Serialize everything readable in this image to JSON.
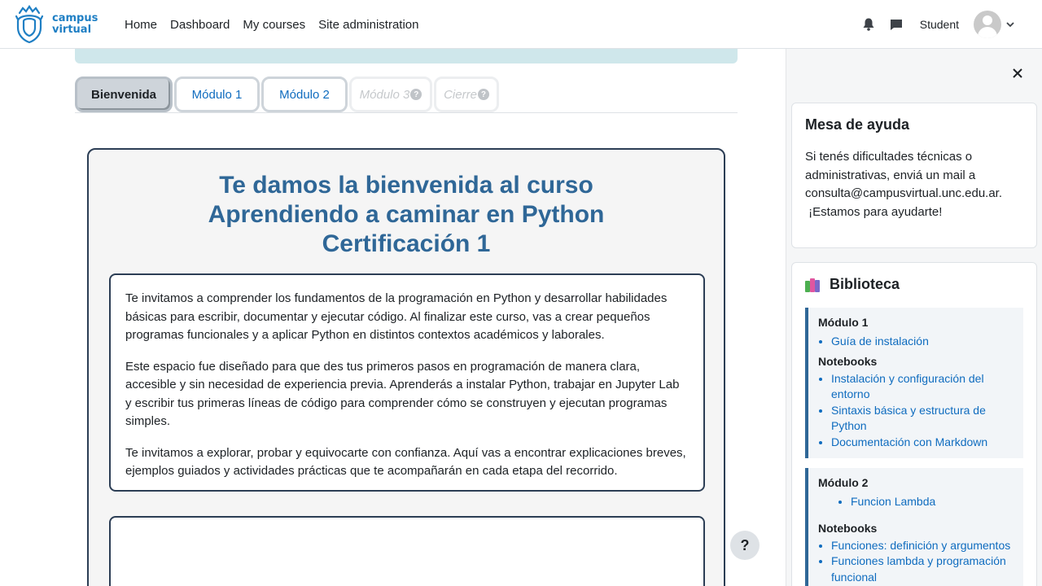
{
  "logo": {
    "line1": "campus",
    "line2": "virtual"
  },
  "nav": {
    "links": [
      "Home",
      "Dashboard",
      "My courses",
      "Site administration"
    ],
    "user": "Student"
  },
  "tabs": [
    {
      "label": "Bienvenida",
      "state": "active"
    },
    {
      "label": "Módulo 1",
      "state": "normal"
    },
    {
      "label": "Módulo 2",
      "state": "normal"
    },
    {
      "label": "Módulo 3",
      "state": "disabled",
      "badge": "?"
    },
    {
      "label": "Cierre",
      "state": "disabled",
      "badge": "?"
    }
  ],
  "course": {
    "title_line1": "Te damos la bienvenida al curso",
    "title_line2": "Aprendiendo a caminar en Python",
    "title_line3": "Certificación 1",
    "paragraphs": [
      "Te invitamos a  comprender los fundamentos de la programación en Python y desarrollar habilidades básicas para escribir, documentar y ejecutar código. Al finalizar este curso, vas a crear pequeños programas funcionales y a aplicar Python en distintos contextos académicos y laborales.",
      "Este espacio fue diseñado para que des tus primeros pasos en programación de manera clara, accesible y sin necesidad de experiencia previa. Aprenderás a instalar Python, trabajar en Jupyter Lab y escribir tus primeras líneas de código para comprender cómo se construyen y ejecutan programas simples.",
      "Te invitamos a explorar, probar y equivocarte con confianza. Aquí vas a encontrar explicaciones breves, ejemplos guiados y actividades prácticas que te acompañarán en cada etapa del recorrido."
    ]
  },
  "help_button": "?",
  "drawer": {
    "help_block": {
      "title": "Mesa de ayuda",
      "text_line1": "Si tenés dificultades técnicas o",
      "text_line2": "administrativas, enviá un mail a",
      "text_line3": "consulta@campusvirtual.unc.edu.ar.",
      "text_line4": " ¡Estamos para ayudarte!"
    },
    "library": {
      "title": "Biblioteca",
      "modules": [
        {
          "title": "Módulo 1",
          "links": [
            "Guía de instalación"
          ],
          "notebooks_label": "Notebooks",
          "notebooks": [
            "Instalación y configuración del entorno",
            "Sintaxis básica y estructura de Python",
            "Documentación con Markdown"
          ]
        },
        {
          "title": "Módulo 2",
          "links": [
            "Funcion Lambda"
          ],
          "notebooks_label": "Notebooks",
          "notebooks": [
            "Funciones: definición y argumentos",
            "Funciones lambda y programación funcional"
          ]
        }
      ]
    }
  },
  "colors": {
    "title_blue": "#2f6797",
    "link_blue": "#0f6cbf",
    "border_dark": "#2c3e55",
    "alert_bg": "#cfe7eb"
  }
}
